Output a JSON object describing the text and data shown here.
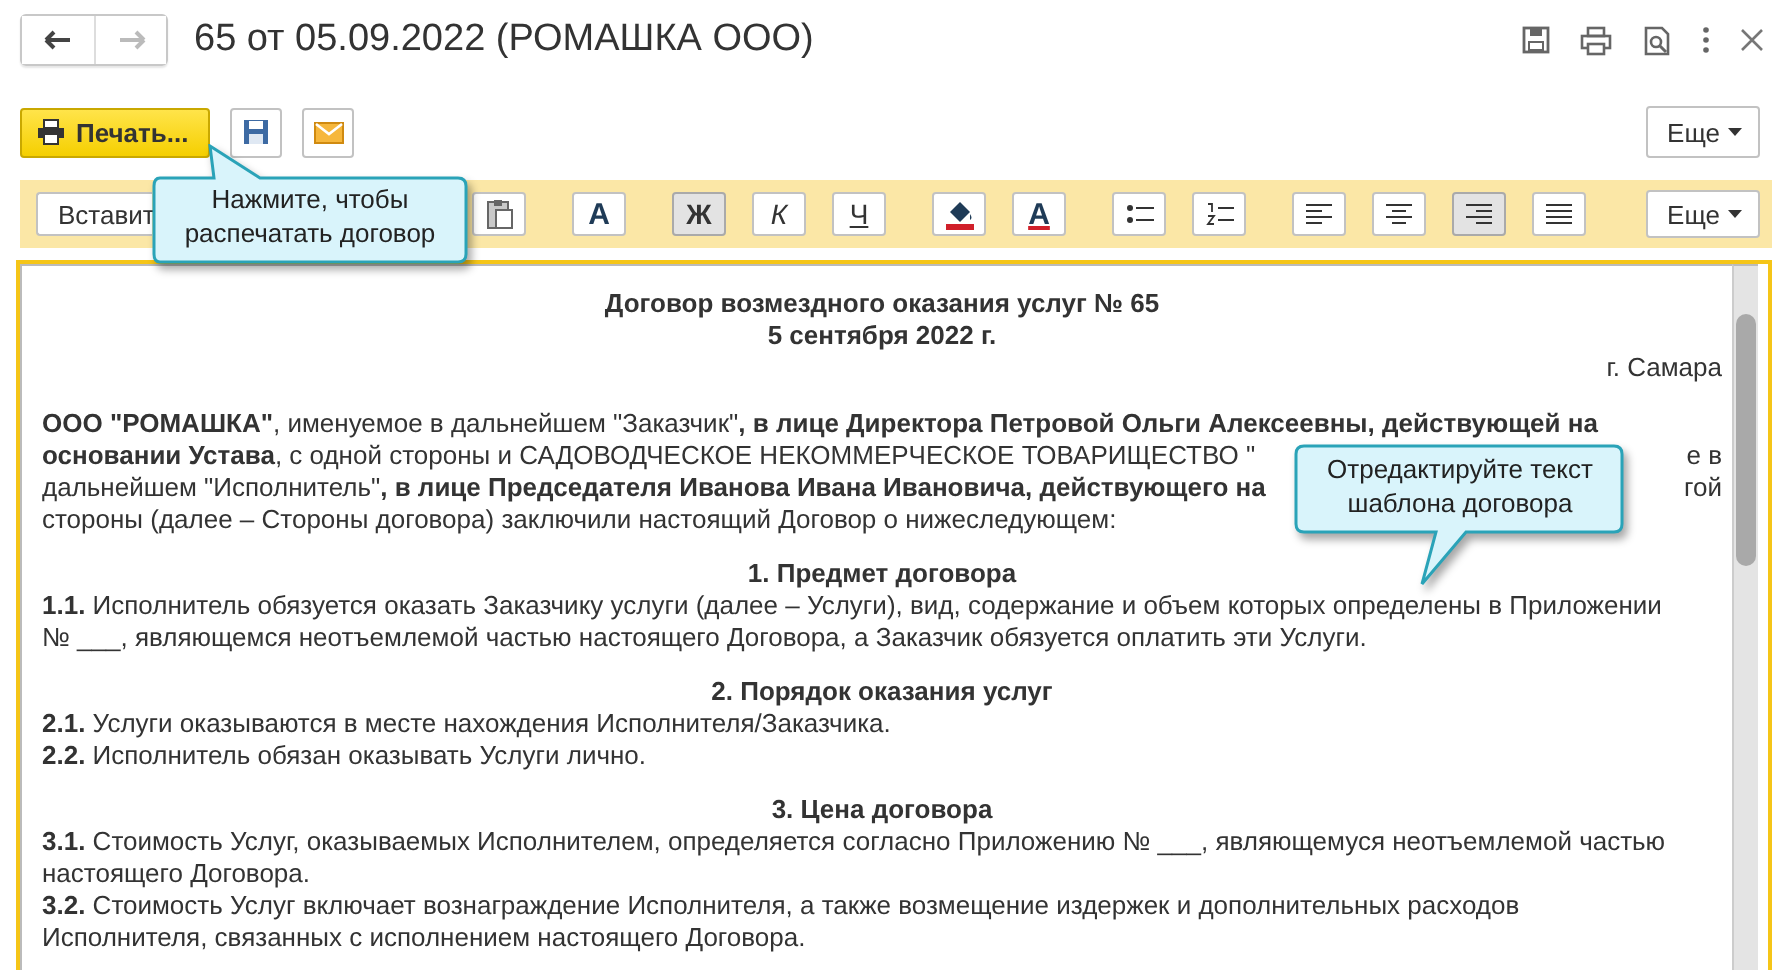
{
  "header": {
    "title": "65 от 05.09.2022 (РОМАШКА ООО)"
  },
  "actions": {
    "print_label": "Печать...",
    "more_label": "Еще"
  },
  "format_toolbar": {
    "buttons": [
      {
        "label": "Вставит",
        "pressed": false
      },
      {
        "pressed": false
      },
      {
        "label": "А",
        "pressed": false
      },
      {
        "label": "Ж",
        "pressed": true
      },
      {
        "label": "К",
        "pressed": false
      },
      {
        "label": "Ч",
        "pressed": false
      },
      {
        "pressed": false
      },
      {
        "label": "А",
        "pressed": false
      },
      {
        "pressed": false
      },
      {
        "pressed": false
      },
      {
        "pressed": false
      },
      {
        "pressed": false
      },
      {
        "pressed": true
      },
      {
        "pressed": false
      }
    ],
    "more_label": "Еще"
  },
  "document": {
    "blocks": [
      {
        "kind": "title",
        "lines": [
          "Договор возмездного оказания услуг № 65",
          "5 сентября 2022 г."
        ]
      },
      {
        "kind": "right",
        "lines": [
          "г. Самара"
        ]
      },
      {
        "kind": "para",
        "lines": [
          {
            "text": "**ООО \"РОМАШКА\"**, именуемое в дальнейшем \"Заказчик\"**, в лице Директора Петровой Ольги Алексеевны, действующей на**"
          },
          {
            "text": "**основании Устава**, с одной стороны и САДОВОДЧЕСКОЕ НЕКОММЕРЧЕСКОЕ ТОВАРИЩЕСТВО \"",
            "tail": "е в"
          },
          {
            "text": "дальнейшем \"Исполнитель\"**, в лице Председателя Иванова Ивана Ивановича, действующего на**",
            "tail": "гой"
          },
          {
            "text": "стороны (далее – Стороны договора) заключили настоящий Договор о нижеследующем:"
          }
        ]
      },
      {
        "kind": "heading",
        "lines": [
          "1. Предмет договора"
        ]
      },
      {
        "kind": "item",
        "lines": [
          "**1.1.** Исполнитель обязуется оказать Заказчику услуги (далее – Услуги), вид, содержание и объем которых определены в Приложении",
          "№ ___, являющемся неотъемлемой частью настоящего Договора, а Заказчик обязуется оплатить эти Услуги."
        ]
      },
      {
        "kind": "heading",
        "lines": [
          "2. Порядок оказания услуг"
        ]
      },
      {
        "kind": "item",
        "lines": [
          "**2.1.** Услуги оказываются в месте нахождения Исполнителя/Заказчика."
        ]
      },
      {
        "kind": "item",
        "lines": [
          "**2.2.** Исполнитель обязан оказывать Услуги лично."
        ]
      },
      {
        "kind": "heading",
        "lines": [
          "3. Цена договора"
        ]
      },
      {
        "kind": "item",
        "lines": [
          "**3.1.** Стоимость Услуг, оказываемых Исполнителем, определяется согласно Приложению № ___, являющемуся неотъемлемой частью",
          "настоящего Договора."
        ]
      },
      {
        "kind": "item",
        "lines": [
          "**3.2.** Стоимость Услуг включает вознаграждение Исполнителя, а также возмещение издержек и дополнительных расходов",
          "Исполнителя, связанных с исполнением настоящего Договора."
        ]
      }
    ]
  },
  "hints": [
    "Нажмите, чтобы распечатать договор",
    "Отредактируйте текст шаблона договора"
  ]
}
